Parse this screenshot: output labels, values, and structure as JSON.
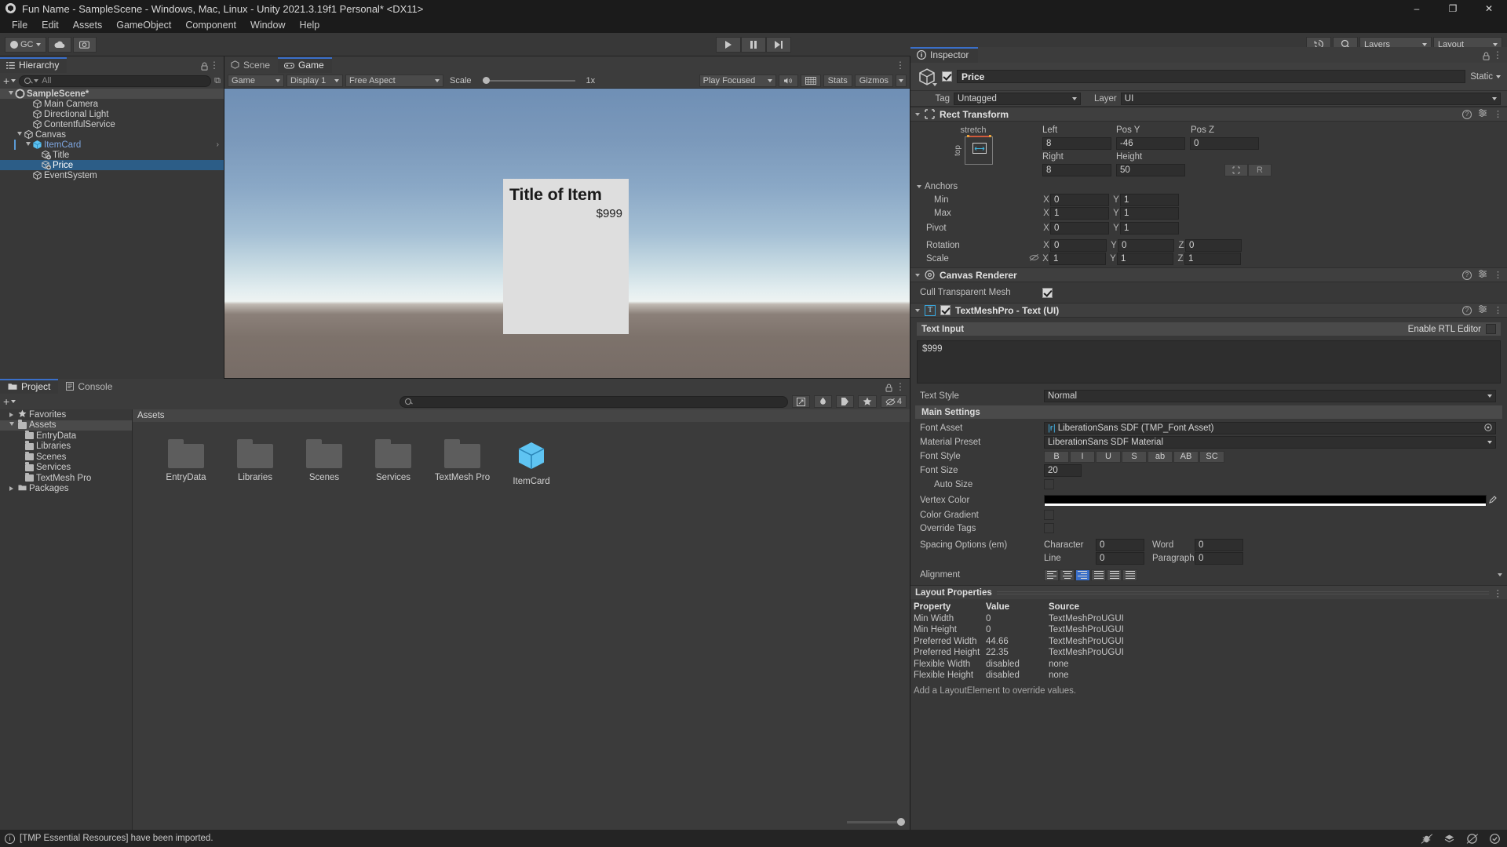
{
  "window": {
    "title": "Fun Name - SampleScene - Windows, Mac, Linux - Unity 2021.3.19f1 Personal* <DX11>",
    "minimize": "–",
    "maximize": "❐",
    "close": "✕"
  },
  "menubar": {
    "items": [
      "File",
      "Edit",
      "Assets",
      "GameObject",
      "Component",
      "Window",
      "Help"
    ]
  },
  "toolbar": {
    "account_label": "GC",
    "cloud_icon": "cloud-icon",
    "collab_icon": "collab-icon",
    "play_icon": "play-icon",
    "pause_icon": "pause-icon",
    "step_icon": "step-icon",
    "undo_history_icon": "undo-history-icon",
    "search_icon": "search-icon",
    "layers_label": "Layers",
    "layout_label": "Layout"
  },
  "hierarchy": {
    "tab_label": "Hierarchy",
    "add_label": "+",
    "search_placeholder": "All",
    "items": [
      {
        "label": "SampleScene*",
        "depth": 0,
        "type": "scene",
        "expanded": true
      },
      {
        "label": "Main Camera",
        "depth": 2,
        "type": "gameobject"
      },
      {
        "label": "Directional Light",
        "depth": 2,
        "type": "gameobject"
      },
      {
        "label": "ContentfulService",
        "depth": 2,
        "type": "gameobject"
      },
      {
        "label": "Canvas",
        "depth": 1,
        "type": "gameobject",
        "expanded": true
      },
      {
        "label": "ItemCard",
        "depth": 2,
        "type": "prefab",
        "expanded": true
      },
      {
        "label": "Title",
        "depth": 3,
        "type": "prefab-child"
      },
      {
        "label": "Price",
        "depth": 3,
        "type": "prefab-child",
        "selected": true
      }
    ],
    "extra": [
      {
        "label": "EventSystem",
        "depth": 2,
        "type": "gameobject"
      }
    ]
  },
  "gameview": {
    "tabs": [
      {
        "label": "Scene",
        "active": false,
        "icon": "scene-icon"
      },
      {
        "label": "Game",
        "active": true,
        "icon": "game-icon"
      }
    ],
    "toolbar": {
      "target": "Game",
      "display": "Display 1",
      "aspect": "Free Aspect",
      "scale_label": "Scale",
      "scale_value": "1x",
      "play_focus": "Play Focused",
      "mute_icon": "mute-audio-icon",
      "gizmo_grid_icon": "gizmo-grid-icon",
      "stats_label": "Stats",
      "gizmos_label": "Gizmos"
    },
    "card": {
      "title": "Title of Item",
      "price": "$999"
    }
  },
  "inspector": {
    "tab_label": "Inspector",
    "lock_icon": "lock-icon",
    "object_name": "Price",
    "enabled": true,
    "static_label": "Static",
    "tag_label": "Tag",
    "tag_value": "Untagged",
    "layer_label": "Layer",
    "layer_value": "UI",
    "rect_transform": {
      "title": "Rect Transform",
      "anchor_preset_h": "stretch",
      "anchor_preset_v": "top",
      "fields": [
        {
          "label": "Left",
          "value": "8"
        },
        {
          "label": "Pos Y",
          "value": "-46"
        },
        {
          "label": "Pos Z",
          "value": "0"
        },
        {
          "label": "Right",
          "value": "8"
        },
        {
          "label": "Height",
          "value": "50"
        }
      ],
      "blueprint_label": "",
      "raw_label": "R",
      "anchors_label": "Anchors",
      "min_label": "Min",
      "min_x": "0",
      "min_y": "1",
      "max_label": "Max",
      "max_x": "1",
      "max_y": "1",
      "pivot_label": "Pivot",
      "pivot_x": "0",
      "pivot_y": "1",
      "rotation_label": "Rotation",
      "rot_x": "0",
      "rot_y": "0",
      "rot_z": "0",
      "scale_label": "Scale",
      "scale_x": "1",
      "scale_y": "1",
      "scale_z": "1"
    },
    "canvas_renderer": {
      "title": "Canvas Renderer",
      "cull_label": "Cull Transparent Mesh",
      "cull_checked": true
    },
    "tmp": {
      "title": "TextMeshPro - Text (UI)",
      "enabled": true,
      "text_input_label": "Text Input",
      "rtl_label": "Enable RTL Editor",
      "rtl_checked": false,
      "text_value": "$999",
      "text_style_label": "Text Style",
      "text_style_value": "Normal",
      "main_settings_label": "Main Settings",
      "font_asset_label": "Font Asset",
      "font_asset_value": "LiberationSans SDF (TMP_Font Asset)",
      "material_preset_label": "Material Preset",
      "material_preset_value": "LiberationSans SDF Material",
      "font_style_label": "Font Style",
      "font_style_buttons": [
        "B",
        "I",
        "U",
        "S",
        "ab",
        "AB",
        "SC"
      ],
      "font_size_label": "Font Size",
      "font_size_value": "20",
      "auto_size_label": "Auto Size",
      "auto_size_checked": false,
      "vertex_color_label": "Vertex Color",
      "vertex_color_value": "#000000",
      "color_gradient_label": "Color Gradient",
      "color_gradient_checked": false,
      "override_tags_label": "Override Tags",
      "override_tags_checked": false,
      "spacing_label": "Spacing Options (em)",
      "character_label": "Character",
      "character_value": "0",
      "word_label": "Word",
      "word_value": "0",
      "line_label": "Line",
      "line_value": "0",
      "paragraph_label": "Paragraph",
      "paragraph_value": "0",
      "alignment_label": "Alignment",
      "alignment_selected_index": 2
    },
    "layout_properties": {
      "title": "Layout Properties",
      "headers": [
        "Property",
        "Value",
        "Source"
      ],
      "rows": [
        {
          "property": "Min Width",
          "value": "0",
          "source": "TextMeshProUGUI"
        },
        {
          "property": "Min Height",
          "value": "0",
          "source": "TextMeshProUGUI"
        },
        {
          "property": "Preferred Width",
          "value": "44.66",
          "source": "TextMeshProUGUI"
        },
        {
          "property": "Preferred Height",
          "value": "22.35",
          "source": "TextMeshProUGUI"
        },
        {
          "property": "Flexible Width",
          "value": "disabled",
          "source": "none"
        },
        {
          "property": "Flexible Height",
          "value": "disabled",
          "source": "none"
        }
      ],
      "footer_note": "Add a LayoutElement to override values."
    }
  },
  "project": {
    "tabs": [
      {
        "label": "Project",
        "active": true,
        "icon": "folder-icon"
      },
      {
        "label": "Console",
        "active": false,
        "icon": "console-icon"
      }
    ],
    "add_label": "+",
    "search_placeholder": "",
    "filter_icons": [
      "save-search-icon",
      "filter-type-icon",
      "filter-label-icon",
      "favorite-icon",
      "hidden-count-icon"
    ],
    "hidden_count": "4",
    "tree": [
      {
        "label": "Favorites",
        "depth": 0,
        "type": "favorites"
      },
      {
        "label": "Assets",
        "depth": 0,
        "type": "folder",
        "selected": true,
        "expanded": true
      },
      {
        "label": "EntryData",
        "depth": 1,
        "type": "folder"
      },
      {
        "label": "Libraries",
        "depth": 1,
        "type": "folder"
      },
      {
        "label": "Scenes",
        "depth": 1,
        "type": "folder"
      },
      {
        "label": "Services",
        "depth": 1,
        "type": "folder"
      },
      {
        "label": "TextMesh Pro",
        "depth": 1,
        "type": "folder"
      },
      {
        "label": "Packages",
        "depth": 0,
        "type": "packages"
      }
    ],
    "breadcrumb": "Assets",
    "grid_items": [
      {
        "label": "EntryData",
        "type": "folder"
      },
      {
        "label": "Libraries",
        "type": "folder"
      },
      {
        "label": "Scenes",
        "type": "folder"
      },
      {
        "label": "Services",
        "type": "folder"
      },
      {
        "label": "TextMesh Pro",
        "type": "folder"
      },
      {
        "label": "ItemCard",
        "type": "prefab"
      }
    ]
  },
  "statusbar": {
    "message": "[TMP Essential Resources] have been imported.",
    "icons": [
      "no-bug-icon",
      "layers-off-icon",
      "no-entry-icon",
      "check-circle-icon"
    ]
  }
}
